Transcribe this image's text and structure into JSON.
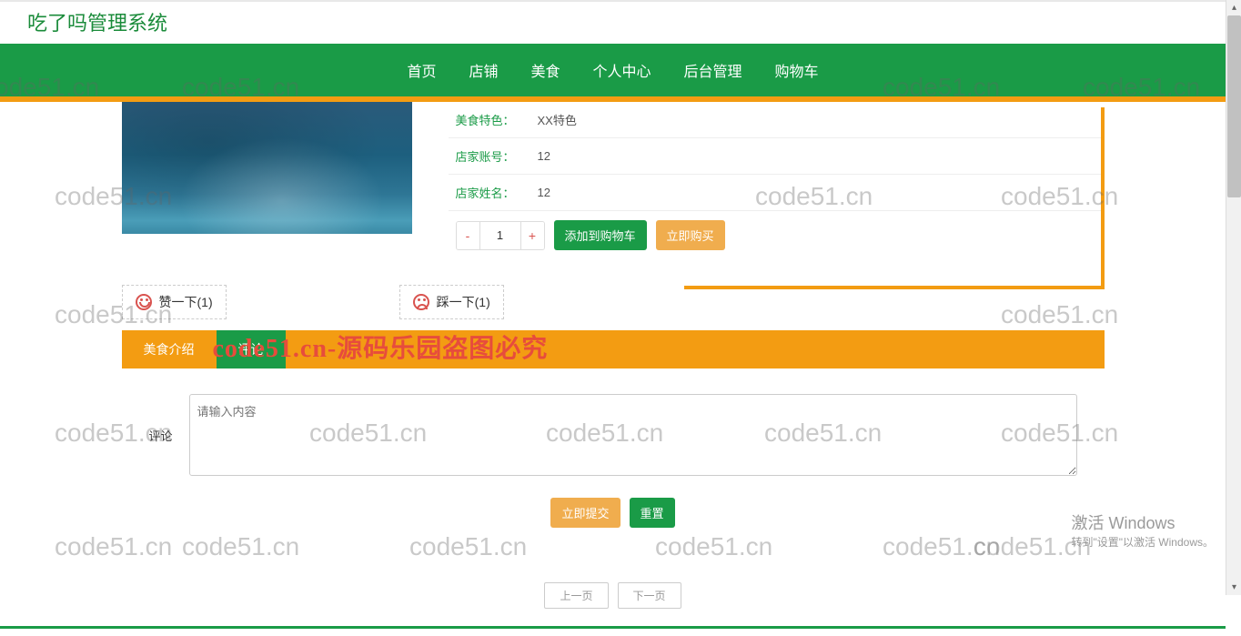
{
  "brand": "吃了吗管理系统",
  "nav": {
    "home": "首页",
    "shop": "店铺",
    "food": "美食",
    "profile": "个人中心",
    "admin": "后台管理",
    "cart": "购物车"
  },
  "product": {
    "feature_label": "美食特色：",
    "feature_value": "XX特色",
    "account_label": "店家账号：",
    "account_value": "12",
    "name_label": "店家姓名：",
    "name_value": "12",
    "qty_minus": "-",
    "qty_value": "1",
    "qty_plus": "+",
    "add_cart": "添加到购物车",
    "buy_now": "立即购买"
  },
  "vote": {
    "like": "赞一下(1)",
    "dislike": "踩一下(1)"
  },
  "tabs": {
    "intro": "美食介绍",
    "reviews": "评论"
  },
  "overlay": "code51.cn-源码乐园盗图必究",
  "comment": {
    "label": "评论",
    "placeholder": "请输入内容",
    "submit": "立即提交",
    "reset": "重置"
  },
  "pager": {
    "prev": "上一页",
    "next": "下一页"
  },
  "watermark": "code51.cn",
  "activate": {
    "line1": "激活 Windows",
    "line2": "转到\"设置\"以激活 Windows。"
  }
}
